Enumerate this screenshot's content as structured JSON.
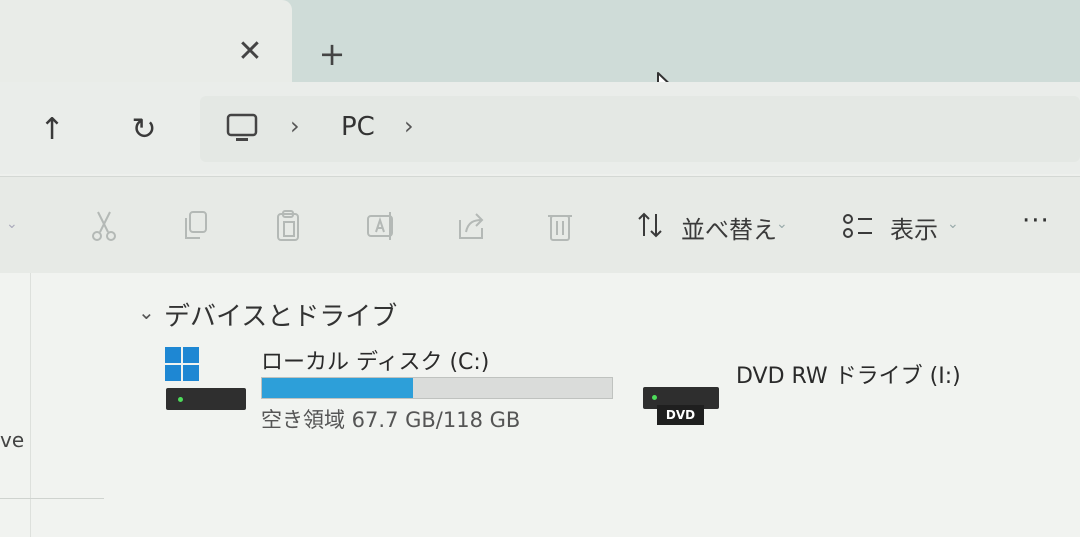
{
  "tabs": {
    "close_glyph": "✕",
    "new_tab_glyph": "+"
  },
  "nav": {
    "up_glyph": "↑",
    "refresh_glyph": "↻"
  },
  "address": {
    "sep1": "›",
    "crumb": "PC",
    "sep2": "›"
  },
  "command_bar": {
    "sort_label": "並べ替え",
    "view_label": "表示",
    "more_label": "···",
    "dropdown_caret": "⌄"
  },
  "section": {
    "title": "デバイスとドライブ",
    "chevron": "⌄"
  },
  "drives": [
    {
      "name": "ローカル ディスク (C:)",
      "free_text": "空き領域 67.7 GB/118 GB",
      "used_fraction": 0.43,
      "bar_color": "#2d9fd9"
    },
    {
      "name": "DVD RW ドライブ (I:)",
      "badge": "DVD"
    }
  ],
  "sidebar": {
    "partial_text": "ve"
  },
  "colors": {
    "accent": "#2d9fd9",
    "tabbar": "#cfdcd8"
  }
}
